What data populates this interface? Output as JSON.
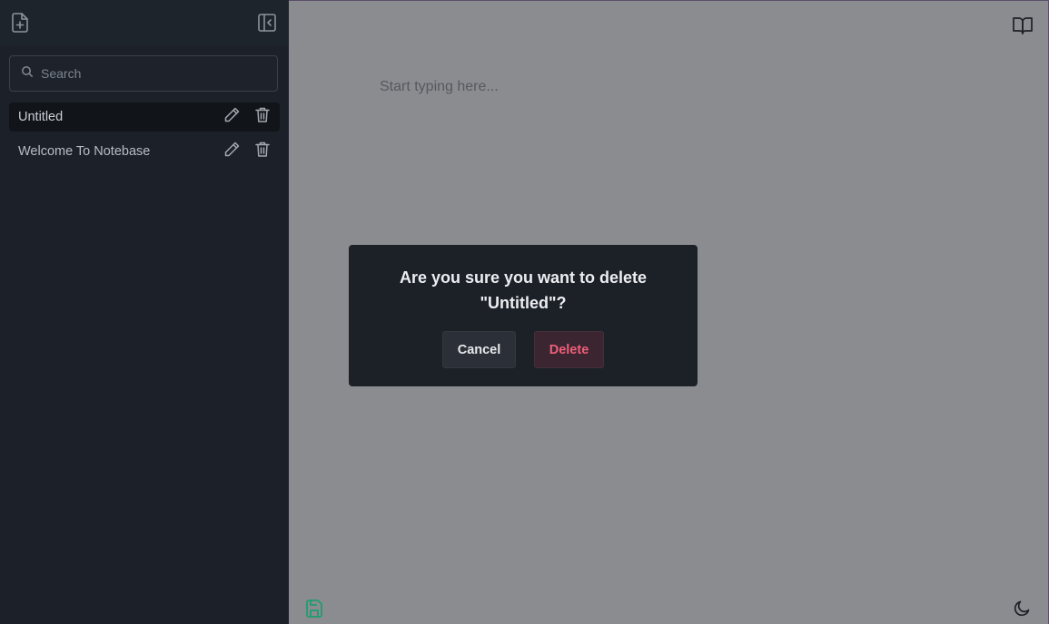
{
  "sidebar": {
    "search": {
      "placeholder": "Search",
      "value": ""
    },
    "notes": [
      {
        "label": "Untitled",
        "active": true
      },
      {
        "label": "Welcome To Notebase",
        "active": false
      }
    ]
  },
  "editor": {
    "placeholder": "Start typing here..."
  },
  "dialog": {
    "title_line1": "Are you sure you want to delete",
    "title_line2": "\"Untitled\"?",
    "cancel_label": "Cancel",
    "delete_label": "Delete"
  },
  "icons": {
    "new_note": "file-plus-icon",
    "collapse_sidebar": "sidebar-collapse-icon",
    "search": "search-icon",
    "edit": "pencil-icon",
    "delete": "trash-icon",
    "read_mode": "book-open-icon",
    "save": "save-icon",
    "theme": "moon-icon"
  },
  "colors": {
    "save_accent": "#1f9d6f",
    "danger": "#ef5f7a"
  }
}
